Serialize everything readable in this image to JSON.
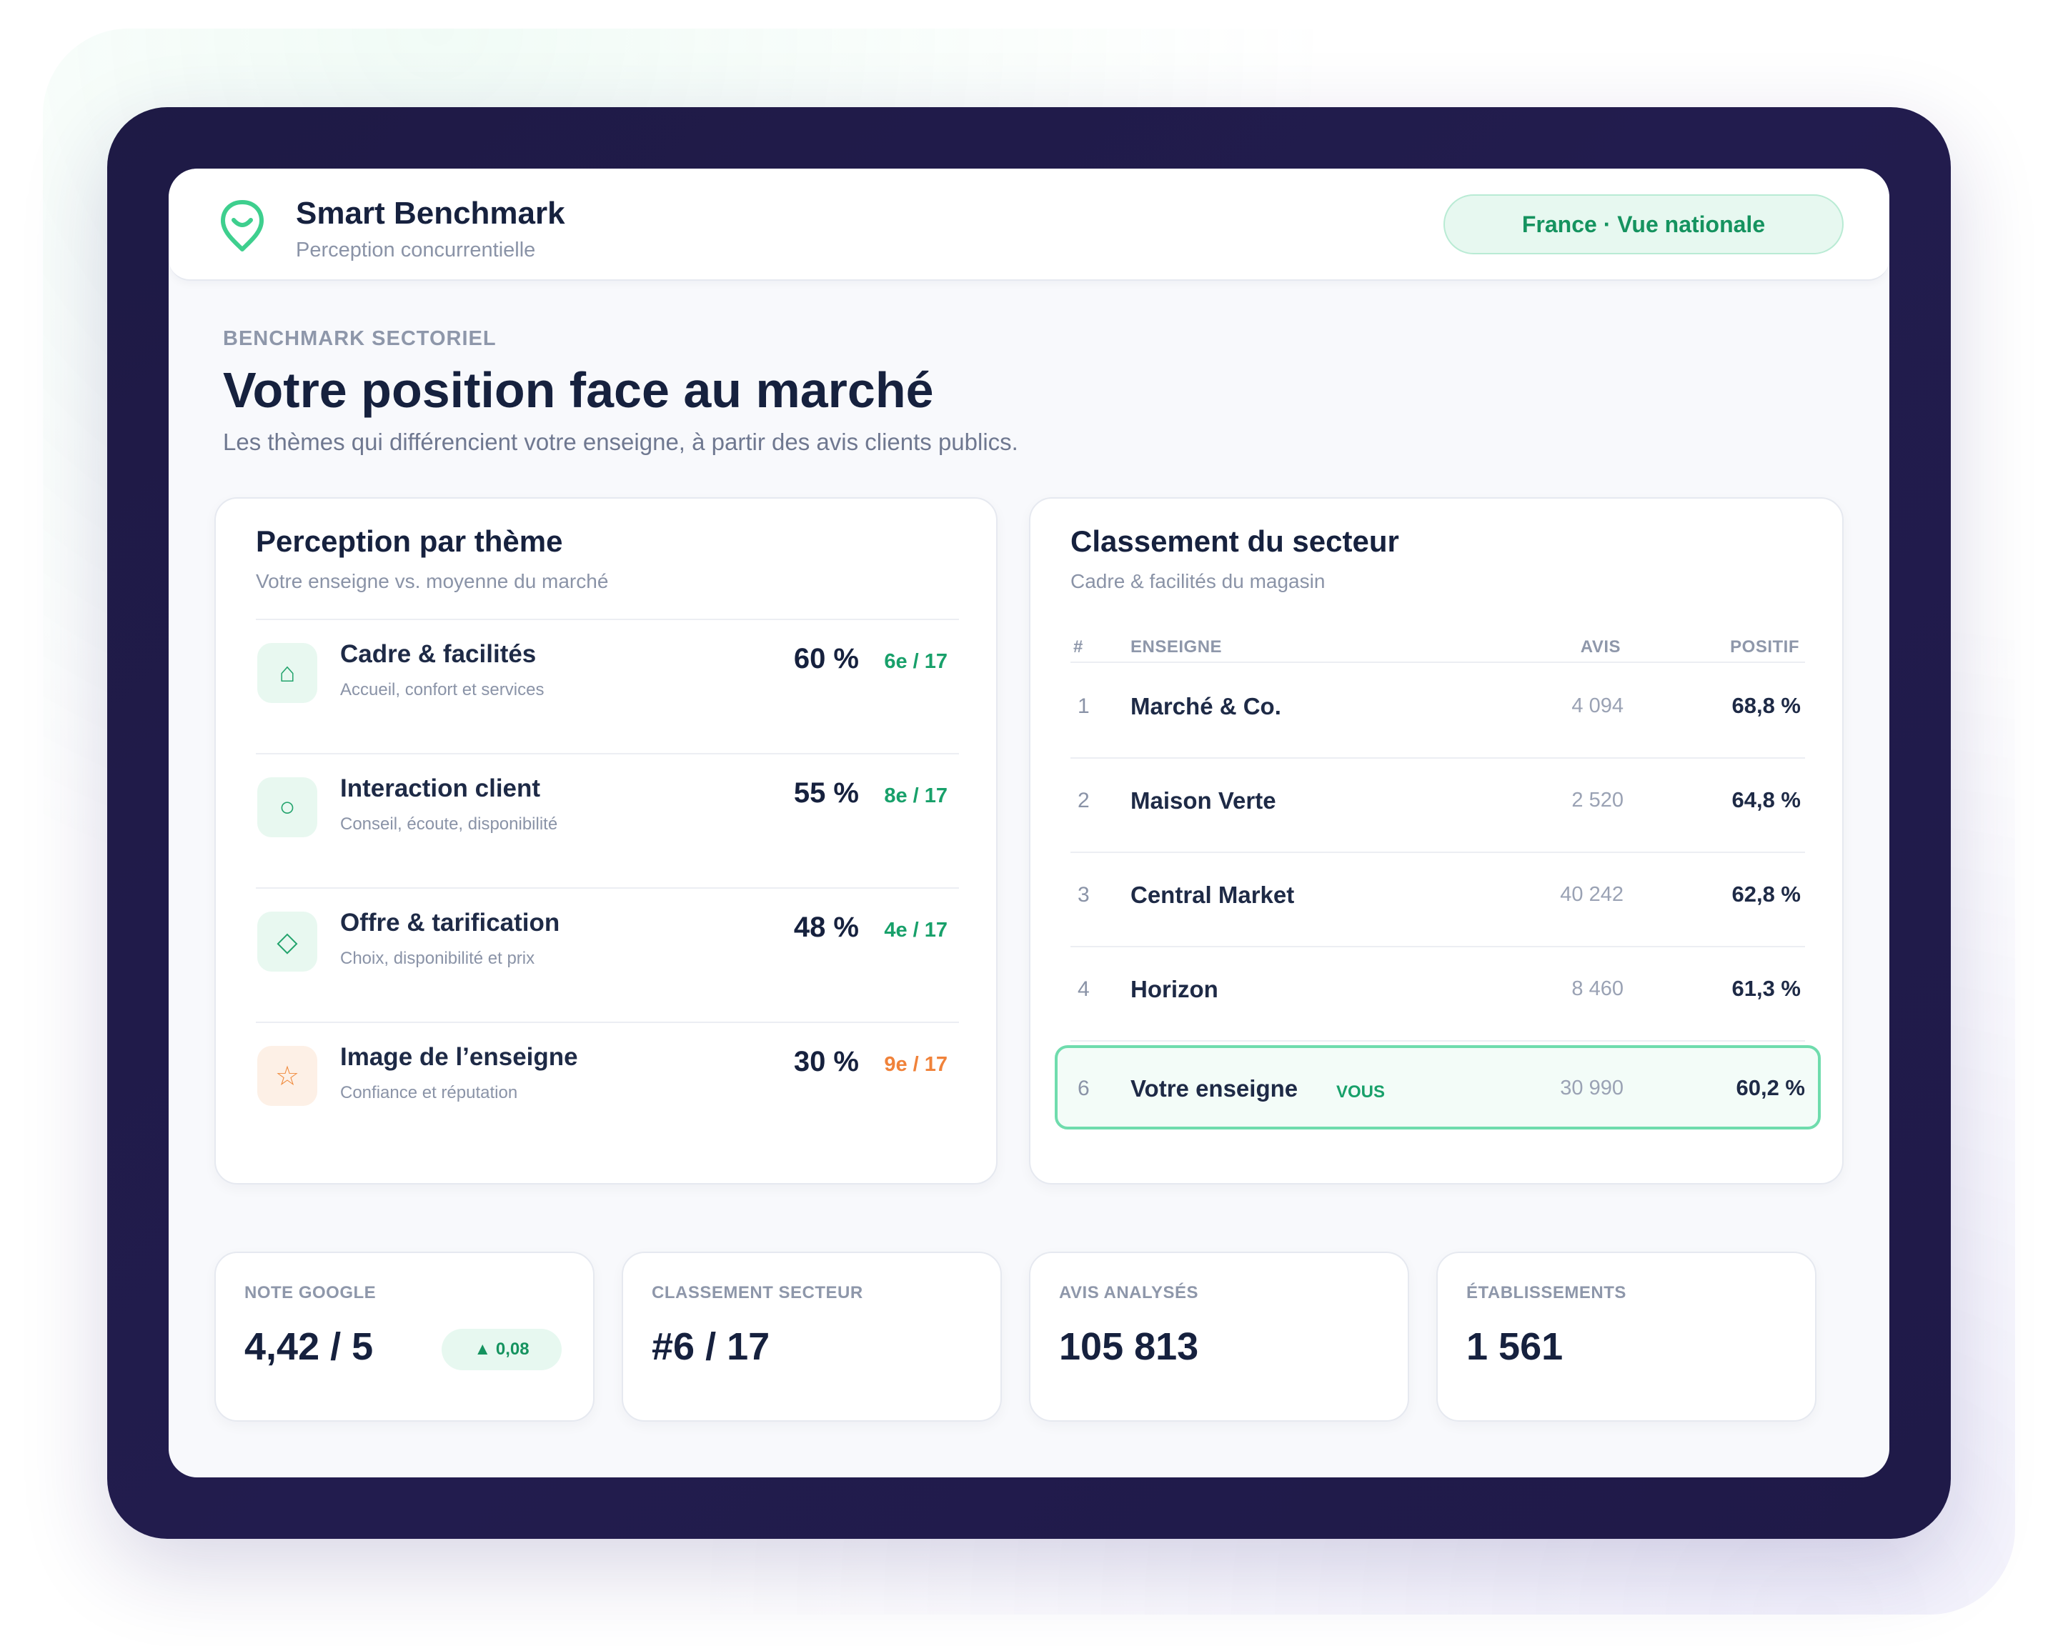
{
  "app": {
    "title": "Smart Benchmark",
    "subtitle": "Perception concurrentielle",
    "region": "France · Vue nationale"
  },
  "header": {
    "eyebrow": "BENCHMARK SECTORIEL",
    "title": "Votre position face au marché",
    "subtitle": "Les thèmes qui différencient votre enseigne, à partir des avis clients publics."
  },
  "themes": {
    "title": "Perception par thème",
    "subtitle": "Votre enseigne vs. moyenne du marché",
    "items": [
      {
        "name": "Cadre & facilités",
        "desc": "Accueil, confort et services",
        "pct": "60 %",
        "rank": "6e / 17",
        "icon": "home-icon",
        "glyph": "⌂",
        "tone": "green"
      },
      {
        "name": "Interaction client",
        "desc": "Conseil, écoute, disponibilité",
        "pct": "55 %",
        "rank": "8e / 17",
        "icon": "circle-icon",
        "glyph": "○",
        "tone": "green"
      },
      {
        "name": "Offre & tarification",
        "desc": "Choix, disponibilité et prix",
        "pct": "48 %",
        "rank": "4e / 17",
        "icon": "diamond-icon",
        "glyph": "◇",
        "tone": "green"
      },
      {
        "name": "Image de l’enseigne",
        "desc": "Confiance et réputation",
        "pct": "30 %",
        "rank": "9e / 17",
        "icon": "star-icon",
        "glyph": "☆",
        "tone": "orange"
      }
    ]
  },
  "ranking": {
    "title": "Classement du secteur",
    "subtitle": "Cadre & facilités du magasin",
    "columns": {
      "num": "#",
      "name": "ENSEIGNE",
      "avis": "AVIS",
      "positive": "POSITIF"
    },
    "rows": [
      {
        "rank": "1",
        "name": "Marché & Co.",
        "avis": "4 094",
        "positive": "68,8 %"
      },
      {
        "rank": "2",
        "name": "Maison Verte",
        "avis": "2 520",
        "positive": "64,8 %"
      },
      {
        "rank": "3",
        "name": "Central Market",
        "avis": "40 242",
        "positive": "62,8 %"
      },
      {
        "rank": "4",
        "name": "Horizon",
        "avis": "8 460",
        "positive": "61,3 %"
      }
    ],
    "you": {
      "rank": "6",
      "name": "Votre enseigne",
      "badge": "VOUS",
      "avis": "30 990",
      "positive": "60,2 %"
    }
  },
  "stats": [
    {
      "label": "NOTE GOOGLE",
      "value": "4,42 / 5",
      "delta": "▲ 0,08"
    },
    {
      "label": "CLASSEMENT SECTEUR",
      "value": "#6 / 17"
    },
    {
      "label": "AVIS ANALYSÉS",
      "value": "105 813"
    },
    {
      "label": "ÉTABLISSEMENTS",
      "value": "1 561"
    }
  ],
  "colors": {
    "accent": "#18a06a",
    "warning": "#f0823a",
    "frame": "#1f1a48",
    "text": "#16213e"
  }
}
